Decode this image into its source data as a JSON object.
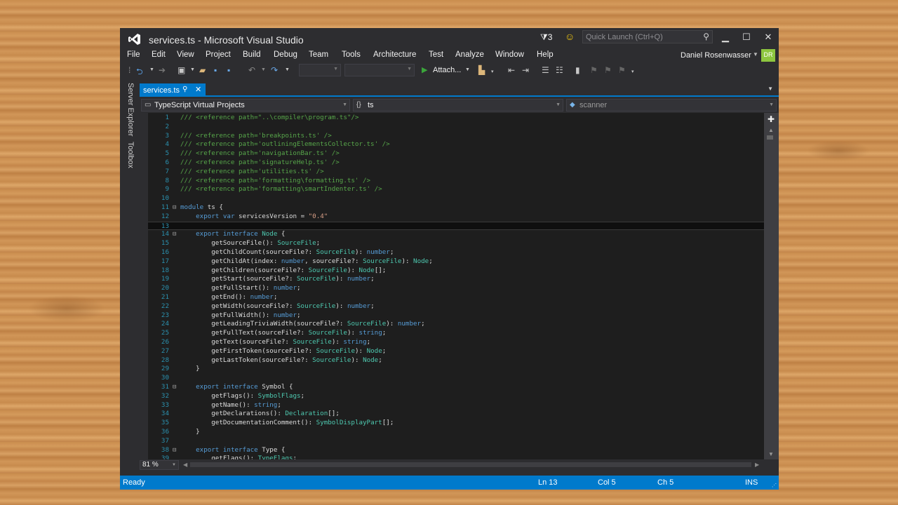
{
  "window": {
    "title": "services.ts - Microsoft Visual Studio",
    "notification_count": "3",
    "quick_launch_placeholder": "Quick Launch (Ctrl+Q)"
  },
  "menu": [
    "File",
    "Edit",
    "View",
    "Project",
    "Build",
    "Debug",
    "Team",
    "Tools",
    "Architecture",
    "Test",
    "Analyze",
    "Window",
    "Help"
  ],
  "user": {
    "name": "Daniel Rosenwasser",
    "initials": "DR"
  },
  "toolbar": {
    "attach_label": "Attach..."
  },
  "side_tabs": [
    "Server Explorer",
    "Toolbox"
  ],
  "document_tab": {
    "label": "services.ts"
  },
  "navigation": {
    "project": "TypeScript Virtual Projects",
    "scope": "ts",
    "member": "scanner"
  },
  "editor": {
    "zoom": "81 %",
    "current_line": 13,
    "lines": [
      {
        "n": "1",
        "fold": "",
        "t": "/// <reference path=\"..\\compiler\\program.ts\"/>"
      },
      {
        "n": "2",
        "fold": "",
        "t": ""
      },
      {
        "n": "3",
        "fold": "",
        "t": "/// <reference path='breakpoints.ts' />"
      },
      {
        "n": "4",
        "fold": "",
        "t": "/// <reference path='outliningElementsCollector.ts' />"
      },
      {
        "n": "5",
        "fold": "",
        "t": "/// <reference path='navigationBar.ts' />"
      },
      {
        "n": "6",
        "fold": "",
        "t": "/// <reference path='signatureHelp.ts' />"
      },
      {
        "n": "7",
        "fold": "",
        "t": "/// <reference path='utilities.ts' />"
      },
      {
        "n": "8",
        "fold": "",
        "t": "/// <reference path='formatting\\formatting.ts' />"
      },
      {
        "n": "9",
        "fold": "",
        "t": "/// <reference path='formatting\\smartIndenter.ts' />"
      },
      {
        "n": "10",
        "fold": "",
        "t": ""
      },
      {
        "n": "11",
        "fold": "⊟",
        "t": "module ts {"
      },
      {
        "n": "12",
        "fold": "",
        "t": "    export var servicesVersion = \"0.4\""
      },
      {
        "n": "13",
        "fold": "",
        "t": ""
      },
      {
        "n": "14",
        "fold": "⊟",
        "t": "    export interface Node {"
      },
      {
        "n": "15",
        "fold": "",
        "t": "        getSourceFile(): SourceFile;"
      },
      {
        "n": "16",
        "fold": "",
        "t": "        getChildCount(sourceFile?: SourceFile): number;"
      },
      {
        "n": "17",
        "fold": "",
        "t": "        getChildAt(index: number, sourceFile?: SourceFile): Node;"
      },
      {
        "n": "18",
        "fold": "",
        "t": "        getChildren(sourceFile?: SourceFile): Node[];"
      },
      {
        "n": "19",
        "fold": "",
        "t": "        getStart(sourceFile?: SourceFile): number;"
      },
      {
        "n": "20",
        "fold": "",
        "t": "        getFullStart(): number;"
      },
      {
        "n": "21",
        "fold": "",
        "t": "        getEnd(): number;"
      },
      {
        "n": "22",
        "fold": "",
        "t": "        getWidth(sourceFile?: SourceFile): number;"
      },
      {
        "n": "23",
        "fold": "",
        "t": "        getFullWidth(): number;"
      },
      {
        "n": "24",
        "fold": "",
        "t": "        getLeadingTriviaWidth(sourceFile?: SourceFile): number;"
      },
      {
        "n": "25",
        "fold": "",
        "t": "        getFullText(sourceFile?: SourceFile): string;"
      },
      {
        "n": "26",
        "fold": "",
        "t": "        getText(sourceFile?: SourceFile): string;"
      },
      {
        "n": "27",
        "fold": "",
        "t": "        getFirstToken(sourceFile?: SourceFile): Node;"
      },
      {
        "n": "28",
        "fold": "",
        "t": "        getLastToken(sourceFile?: SourceFile): Node;"
      },
      {
        "n": "29",
        "fold": "",
        "t": "    }"
      },
      {
        "n": "30",
        "fold": "",
        "t": ""
      },
      {
        "n": "31",
        "fold": "⊟",
        "t": "    export interface Symbol {"
      },
      {
        "n": "32",
        "fold": "",
        "t": "        getFlags(): SymbolFlags;"
      },
      {
        "n": "33",
        "fold": "",
        "t": "        getName(): string;"
      },
      {
        "n": "34",
        "fold": "",
        "t": "        getDeclarations(): Declaration[];"
      },
      {
        "n": "35",
        "fold": "",
        "t": "        getDocumentationComment(): SymbolDisplayPart[];"
      },
      {
        "n": "36",
        "fold": "",
        "t": "    }"
      },
      {
        "n": "37",
        "fold": "",
        "t": ""
      },
      {
        "n": "38",
        "fold": "⊟",
        "t": "    export interface Type {"
      },
      {
        "n": "39",
        "fold": "",
        "t": "        getFlags(): TypeFlags;"
      }
    ]
  },
  "status": {
    "message": "Ready",
    "line": "Ln 13",
    "col": "Col 5",
    "ch": "Ch 5",
    "mode": "INS"
  },
  "colors": {
    "accent": "#007acc",
    "comment": "#57a64a",
    "keyword": "#569cd6",
    "string": "#d69d85",
    "type": "#4ec9b0",
    "line_number": "#2b91af"
  }
}
